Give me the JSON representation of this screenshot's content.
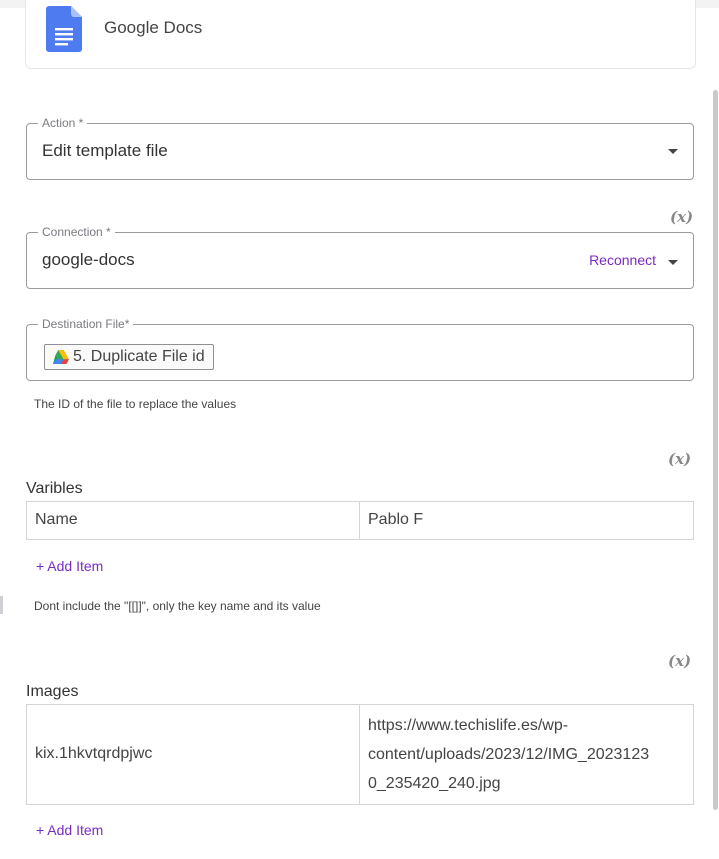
{
  "app": {
    "name": "Google Docs",
    "icon": "google-docs-icon"
  },
  "action": {
    "label": "Action *",
    "value": "Edit template file"
  },
  "connection": {
    "label": "Connection *",
    "value": "google-docs",
    "reconnect_label": "Reconnect",
    "fx_label": "(x)"
  },
  "destination_file": {
    "label": "Destination File*",
    "chip_label": "5. Duplicate File id",
    "chip_icon": "google-drive-icon",
    "help": "The ID of the file to replace the values"
  },
  "variables": {
    "fx_label": "(x)",
    "label": "Varibles",
    "rows": [
      {
        "key": "Name",
        "value": "Pablo F"
      }
    ],
    "add_item": "+ Add Item",
    "help": "Dont include the \"[[]]\", only the key name and its value"
  },
  "images": {
    "fx_label": "(x)",
    "label": "Images",
    "rows": [
      {
        "key": "kix.1hkvtqrdpjwc",
        "value_lines": [
          "https://www.techislife.es/wp-",
          "content/uploads/2023/12/IMG_2023123",
          "0_235420_240.jpg"
        ]
      }
    ],
    "add_item": "+ Add Item"
  },
  "colors": {
    "accent": "#7b2bc4",
    "docs_blue": "#4285f4",
    "border": "#9a9a9e"
  }
}
